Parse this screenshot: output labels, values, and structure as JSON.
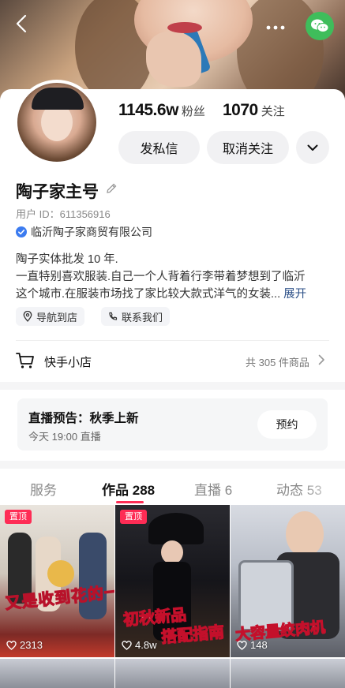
{
  "header": {
    "back_icon": "chevron-left-icon",
    "more_icon": "more-dots-icon",
    "wechat_icon": "wechat-icon"
  },
  "profile": {
    "followers_value": "1145.6w",
    "followers_label": "粉丝",
    "following_value": "1070",
    "following_label": "关注",
    "message_button": "发私信",
    "unfollow_button": "取消关注",
    "name": "陶子家主号",
    "user_id": "用户 ID：611356916",
    "verification": "临沂陶子家商贸有限公司",
    "bio_lines": [
      "陶子实体批发 10 年.",
      "一直特别喜欢服装.自己一个人背着行李带着梦想到了临沂",
      "这个城市.在服装市场找了家比较大款式洋气的女装..."
    ],
    "bio_expand": "展开",
    "tags": [
      "导航到店",
      "联系我们"
    ]
  },
  "shop": {
    "label": "快手小店",
    "count": "共 305 件商品"
  },
  "live": {
    "title": "直播预告：秋季上新",
    "time": "今天 19:00 直播",
    "reserve_button": "预约"
  },
  "tabs": [
    {
      "label": "服务",
      "count": ""
    },
    {
      "label": "作品",
      "count": "288"
    },
    {
      "label": "直播",
      "count": "6"
    },
    {
      "label": "动态",
      "count": "53"
    }
  ],
  "videos": [
    {
      "pinned": "置顶",
      "caption": "又是收到花的一天",
      "likes": "2313"
    },
    {
      "pinned": "置顶",
      "caption_line1": "初秋新品",
      "caption_line2": "搭配指南",
      "likes": "4.8w"
    },
    {
      "pinned": "",
      "caption": "大容量绞肉机",
      "likes": "148"
    }
  ],
  "colors": {
    "accent": "#fe2c55",
    "wechat": "#3fbd5b",
    "verify": "#3b7bf0",
    "link": "#2b4f87"
  }
}
